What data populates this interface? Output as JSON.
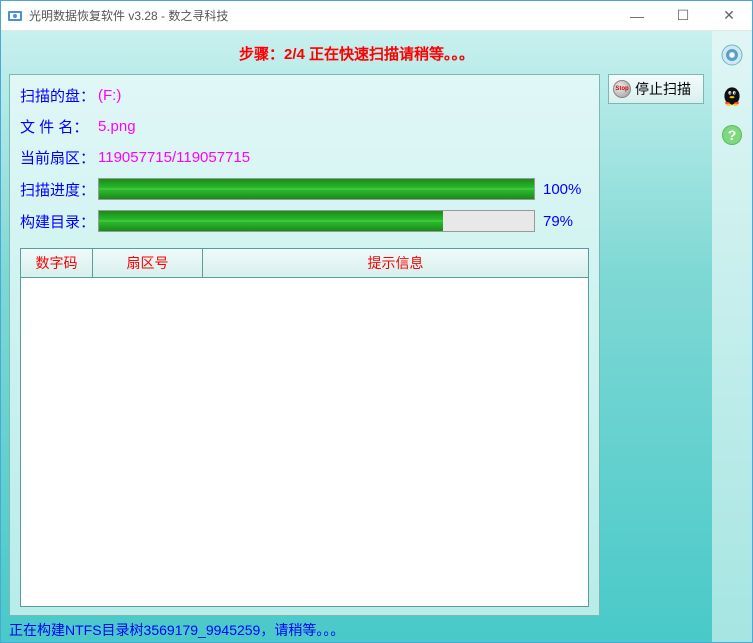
{
  "window": {
    "title": "光明数据恢复软件 v3.28 - 数之寻科技"
  },
  "step": "步骤：2/4 正在快速扫描请稍等。。。",
  "stop": {
    "label": "停止扫描"
  },
  "info": {
    "disk_label": "扫描的盘：",
    "disk_value": "(F:)",
    "file_label": "文 件 名：",
    "file_value": "5.png",
    "sector_label": "当前扇区：",
    "sector_value": "119057715/119057715"
  },
  "progress": {
    "scan_label": "扫描进度：",
    "scan_pct": "100%",
    "scan_width": "100%",
    "build_label": "构建目录：",
    "build_pct": "79%",
    "build_width": "79%"
  },
  "table": {
    "col1": "数字码",
    "col2": "扇区号",
    "col3": "提示信息"
  },
  "status": "正在构建NTFS目录树3569179_9945259，请稍等。。。"
}
